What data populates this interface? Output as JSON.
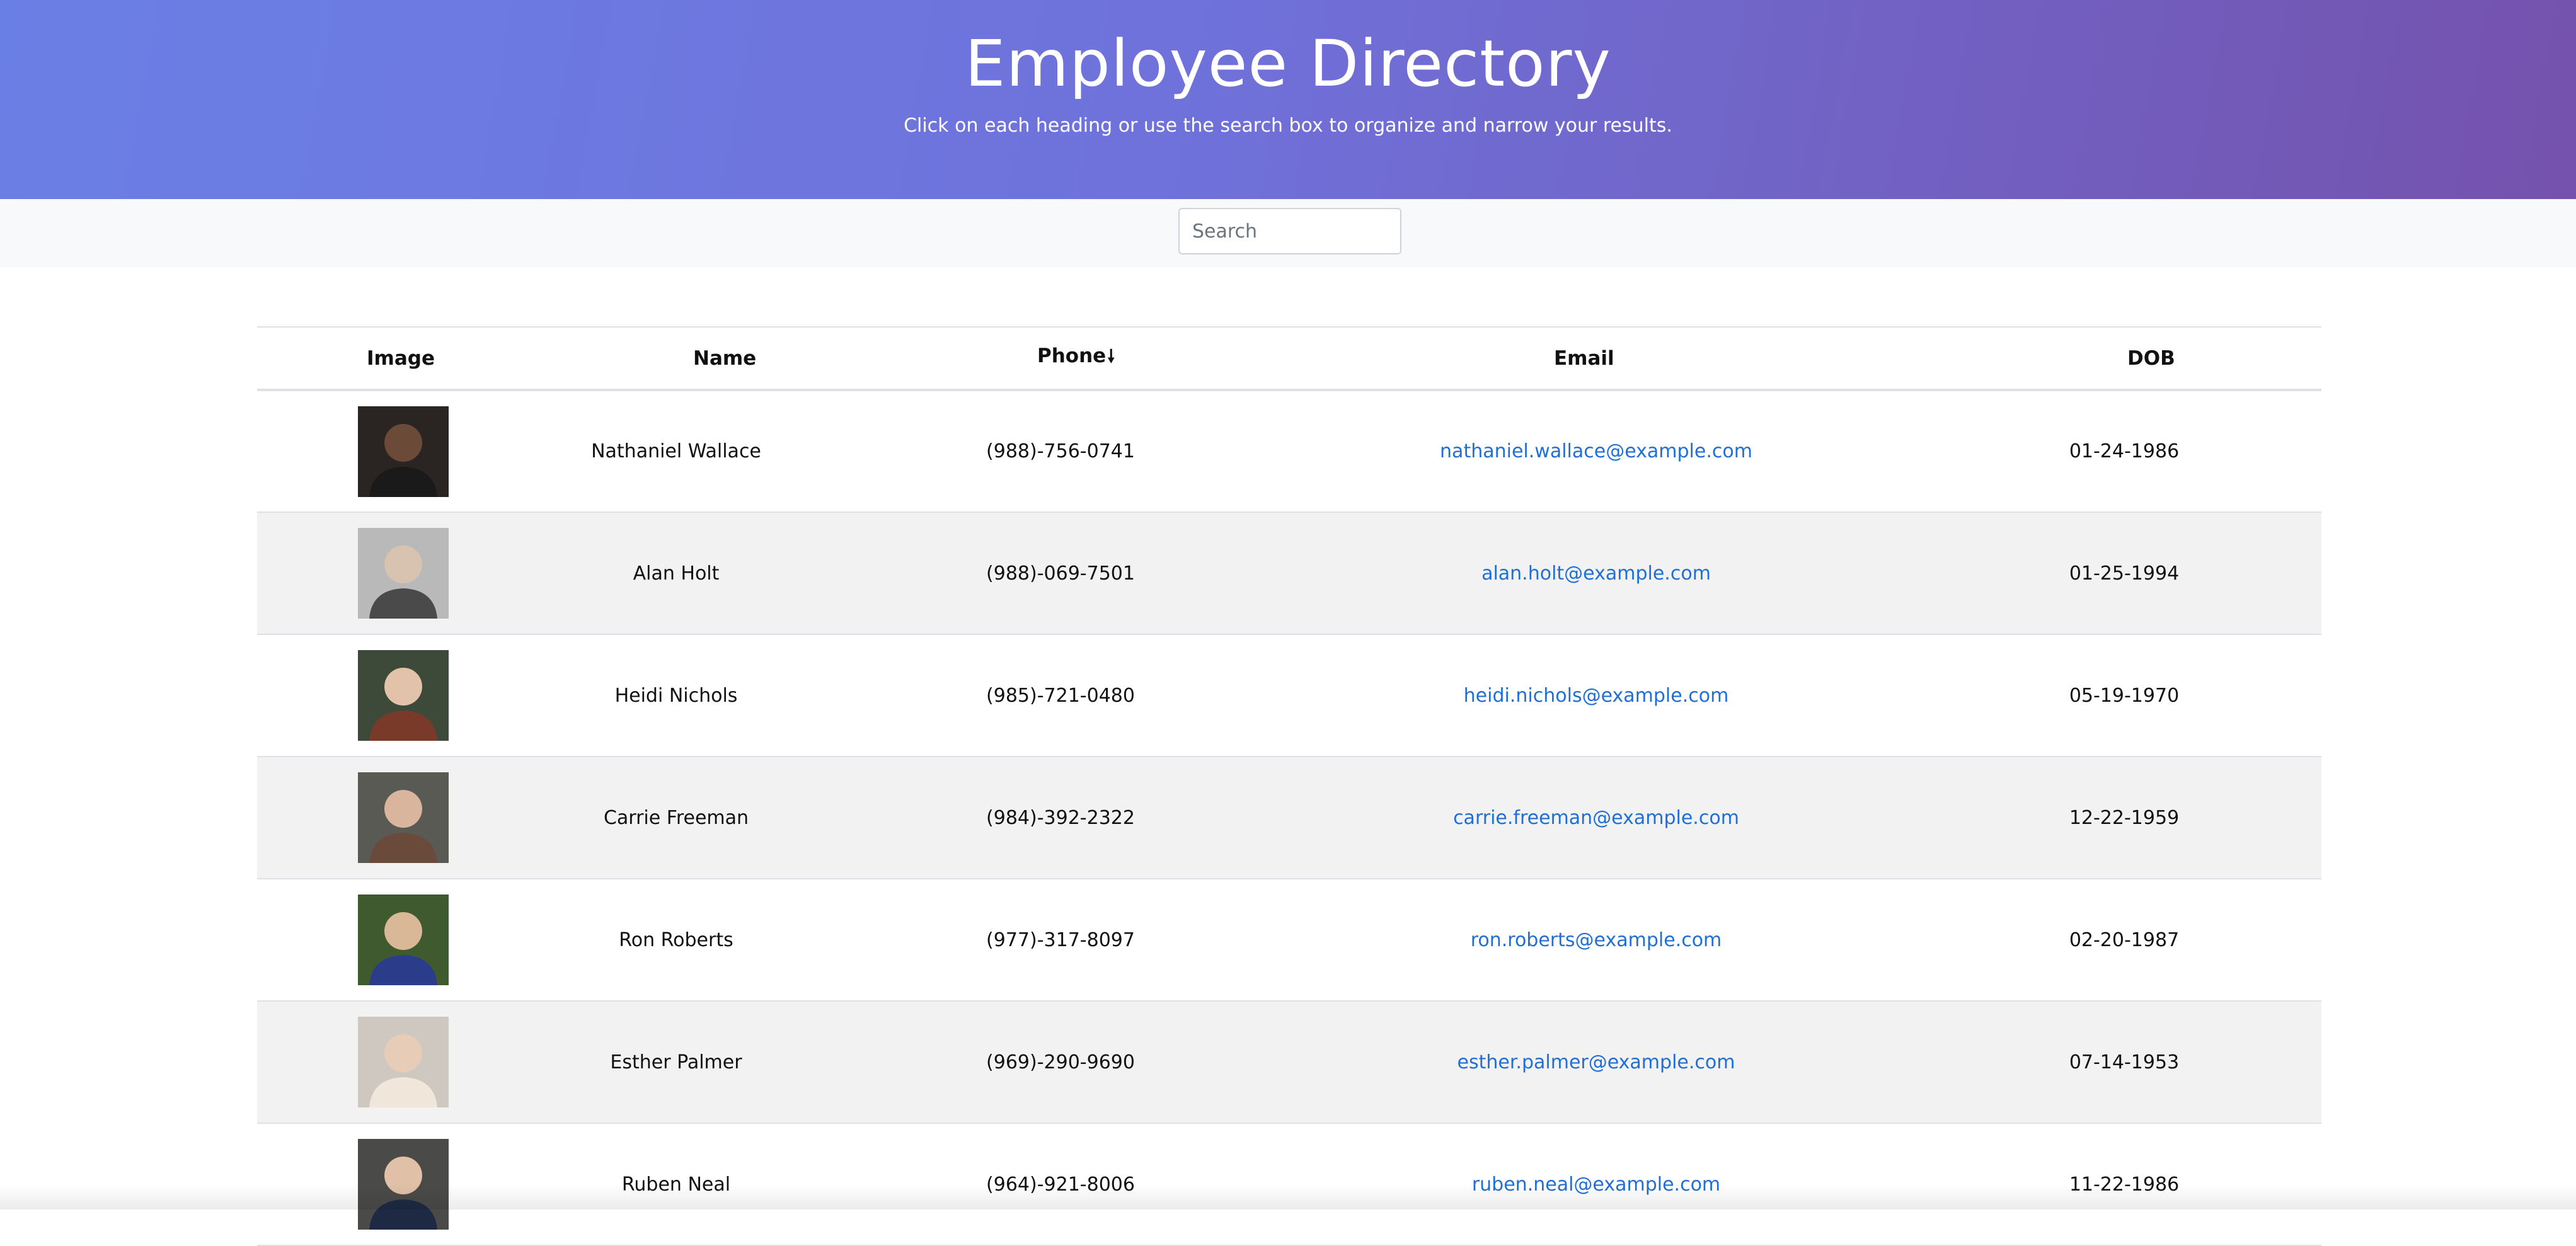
{
  "header": {
    "title": "Employee Directory",
    "subtitle": "Click on each heading or use the search box to organize and narrow your results."
  },
  "search": {
    "placeholder": "Search",
    "value": ""
  },
  "table": {
    "columns": {
      "image": "Image",
      "name": "Name",
      "phone": "Phone",
      "phone_sort_indicator": "🠗",
      "email": "Email",
      "dob": "DOB"
    },
    "rows": [
      {
        "name": "Nathaniel Wallace",
        "phone": "(988)-756-0741",
        "email": "nathaniel.wallace@example.com",
        "dob": "01-24-1986",
        "avatar_icon": "person-photo"
      },
      {
        "name": "Alan Holt",
        "phone": "(988)-069-7501",
        "email": "alan.holt@example.com",
        "dob": "01-25-1994",
        "avatar_icon": "person-photo"
      },
      {
        "name": "Heidi Nichols",
        "phone": "(985)-721-0480",
        "email": "heidi.nichols@example.com",
        "dob": "05-19-1970",
        "avatar_icon": "person-photo"
      },
      {
        "name": "Carrie Freeman",
        "phone": "(984)-392-2322",
        "email": "carrie.freeman@example.com",
        "dob": "12-22-1959",
        "avatar_icon": "person-photo"
      },
      {
        "name": "Ron Roberts",
        "phone": "(977)-317-8097",
        "email": "ron.roberts@example.com",
        "dob": "02-20-1987",
        "avatar_icon": "person-photo"
      },
      {
        "name": "Esther Palmer",
        "phone": "(969)-290-9690",
        "email": "esther.palmer@example.com",
        "dob": "07-14-1953",
        "avatar_icon": "person-photo"
      },
      {
        "name": "Ruben Neal",
        "phone": "(964)-921-8006",
        "email": "ruben.neal@example.com",
        "dob": "11-22-1986",
        "avatar_icon": "person-photo"
      }
    ]
  },
  "colors": {
    "header_gradient_start": "#6a7fe5",
    "header_gradient_end": "#7452ad",
    "link": "#1f6fd6",
    "striped_row": "#f2f2f2",
    "search_bar_bg": "#f8f9fa"
  }
}
